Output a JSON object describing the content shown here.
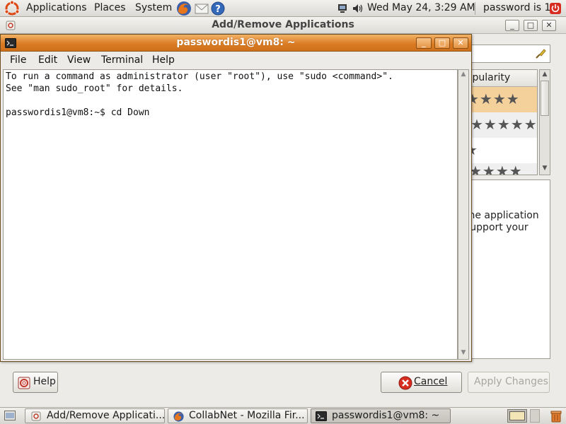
{
  "top_panel": {
    "menus": [
      "Applications",
      "Places",
      "System"
    ],
    "clock": "Wed May 24,  3:29 AM",
    "user": "password is 1"
  },
  "addremove": {
    "title": "Add/Remove Applications",
    "column_header": "Popularity",
    "rows": [
      "★★★★",
      "★★★★★",
      "★",
      "★★★★"
    ],
    "desc_lines": [
      "the application",
      "support your"
    ],
    "help_label": "Help",
    "cancel_label": "Cancel",
    "apply_label": "Apply Changes"
  },
  "terminal": {
    "title": "passwordis1@vm8: ~",
    "menu": [
      "File",
      "Edit",
      "View",
      "Terminal",
      "Help"
    ],
    "lines": [
      "To run a command as administrator (user \"root\"), use \"sudo <command>\".",
      "See \"man sudo_root\" for details.",
      "",
      "passwordis1@vm8:~$ cd Down"
    ]
  },
  "taskbar": {
    "tasks": [
      "Add/Remove Applicati...",
      "CollabNet - Mozilla Fir...",
      "passwordis1@vm8: ~"
    ]
  },
  "colors": {
    "terminal_titlebar": "#db7d25",
    "panel": "#dcdad5",
    "cancel_icon": "#d62d20"
  }
}
